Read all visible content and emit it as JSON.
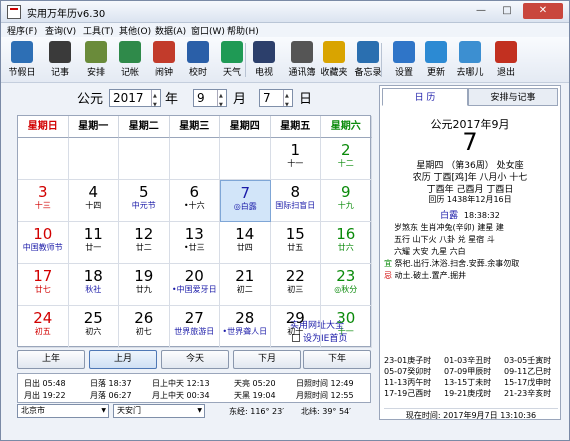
{
  "app": {
    "title": "实用万年历v6.30",
    "min": "—",
    "max": "□",
    "close": "✕"
  },
  "menu": [
    "程序(F)",
    "查询(V)",
    "工具(T)",
    "其他(O)",
    "数据(A)",
    "窗口(W)",
    "帮助(H)"
  ],
  "toolbar": [
    {
      "label": "节假日",
      "icon": "calendar-holiday-icon",
      "color": "#2d6fb5"
    },
    {
      "label": "记事",
      "icon": "notebook-icon",
      "color": "#3a3a3a"
    },
    {
      "label": "安排",
      "icon": "schedule-grid-icon",
      "color": "#6a8b3a"
    },
    {
      "label": "记帐",
      "icon": "ledger-icon",
      "color": "#2f8a4a"
    },
    {
      "label": "闹钟",
      "icon": "alarm-clock-icon",
      "color": "#c23b2b"
    },
    {
      "label": "校时",
      "icon": "globe-clock-icon",
      "color": "#2a5fa8"
    },
    {
      "label": "天气",
      "icon": "weather-icon",
      "color": "#1f9a55"
    },
    {
      "label": "电视",
      "icon": "tv-icon",
      "color": "#2c3f6b"
    },
    {
      "label": "通讯簿",
      "icon": "camera-contacts-icon",
      "color": "#555555"
    },
    {
      "label": "收藏夹",
      "icon": "star-favorites-icon",
      "color": "#d9a400"
    },
    {
      "label": "备忘录",
      "icon": "memo-icon",
      "color": "#2a6fb0"
    },
    {
      "label": "设置",
      "icon": "settings-icon",
      "color": "#2f75c8"
    },
    {
      "label": "更新",
      "icon": "update-globe-icon",
      "color": "#2c8ad3"
    },
    {
      "label": "去哪儿",
      "icon": "camel-icon",
      "color": "#3c8fd1"
    },
    {
      "label": "退出",
      "icon": "exit-icon",
      "color": "#c23020"
    }
  ],
  "nav": {
    "era": "公元",
    "year": "2017",
    "year_unit": "年",
    "month": "9",
    "month_unit": "月",
    "day": "7",
    "day_unit": "日"
  },
  "weekdays": [
    "星期日",
    "星期一",
    "星期二",
    "星期三",
    "星期四",
    "星期五",
    "星期六"
  ],
  "cells": [
    {
      "d": "",
      "l": "",
      "dc": "black",
      "lc": "black"
    },
    {
      "d": "",
      "l": "",
      "dc": "black",
      "lc": "black"
    },
    {
      "d": "",
      "l": "",
      "dc": "black",
      "lc": "black"
    },
    {
      "d": "",
      "l": "",
      "dc": "black",
      "lc": "black"
    },
    {
      "d": "",
      "l": "",
      "dc": "black",
      "lc": "black"
    },
    {
      "d": "1",
      "l": "十一",
      "dc": "black",
      "lc": "black"
    },
    {
      "d": "2",
      "l": "十二",
      "dc": "green",
      "lc": "green"
    },
    {
      "d": "3",
      "l": "十三",
      "dc": "red",
      "lc": "red"
    },
    {
      "d": "4",
      "l": "十四",
      "dc": "black",
      "lc": "black"
    },
    {
      "d": "5",
      "l": "中元节",
      "dc": "black",
      "lc": "blue"
    },
    {
      "d": "6",
      "l": "•十六",
      "dc": "black",
      "lc": "black"
    },
    {
      "d": "7",
      "l": "◎白露",
      "dc": "blue",
      "lc": "blue",
      "today": true
    },
    {
      "d": "8",
      "l": "国际扫盲日",
      "dc": "black",
      "lc": "blue"
    },
    {
      "d": "9",
      "l": "十九",
      "dc": "green",
      "lc": "green"
    },
    {
      "d": "10",
      "l": "中国教师节",
      "dc": "red",
      "lc": "blue"
    },
    {
      "d": "11",
      "l": "廿一",
      "dc": "black",
      "lc": "black"
    },
    {
      "d": "12",
      "l": "廿二",
      "dc": "black",
      "lc": "black"
    },
    {
      "d": "13",
      "l": "•廿三",
      "dc": "black",
      "lc": "black"
    },
    {
      "d": "14",
      "l": "廿四",
      "dc": "black",
      "lc": "black"
    },
    {
      "d": "15",
      "l": "廿五",
      "dc": "black",
      "lc": "black"
    },
    {
      "d": "16",
      "l": "廿六",
      "dc": "green",
      "lc": "green"
    },
    {
      "d": "17",
      "l": "廿七",
      "dc": "red",
      "lc": "red"
    },
    {
      "d": "18",
      "l": "秋社",
      "dc": "black",
      "lc": "blue"
    },
    {
      "d": "19",
      "l": "廿九",
      "dc": "black",
      "lc": "black"
    },
    {
      "d": "20",
      "l": "•中国爱牙日",
      "dc": "black",
      "lc": "blue"
    },
    {
      "d": "21",
      "l": "初二",
      "dc": "black",
      "lc": "black"
    },
    {
      "d": "22",
      "l": "初三",
      "dc": "black",
      "lc": "black"
    },
    {
      "d": "23",
      "l": "◎秋分",
      "dc": "green",
      "lc": "green"
    },
    {
      "d": "24",
      "l": "初五",
      "dc": "red",
      "lc": "red"
    },
    {
      "d": "25",
      "l": "初六",
      "dc": "black",
      "lc": "black"
    },
    {
      "d": "26",
      "l": "初七",
      "dc": "black",
      "lc": "black"
    },
    {
      "d": "27",
      "l": "世界旅游日",
      "dc": "black",
      "lc": "blue"
    },
    {
      "d": "28",
      "l": "•世界聋人日",
      "dc": "black",
      "lc": "blue"
    },
    {
      "d": "29",
      "l": "初十",
      "dc": "black",
      "lc": "black"
    },
    {
      "d": "30",
      "l": "十一",
      "dc": "green",
      "lc": "green"
    }
  ],
  "links": {
    "site": "实用网址大全",
    "homepage": "设为IE首页"
  },
  "buttons": [
    "上年",
    "上月",
    "今天",
    "下月",
    "下年"
  ],
  "sun": {
    "rise": "日出 05:48",
    "set": "日落 18:37",
    "transit": "日上中天 12:13",
    "dawn": "天亮 05:20",
    "dur": "日照时间 12:49",
    "moonrise": "月出 19:22",
    "moonset": "月落 06:27",
    "mtransit": "月上中天 00:34",
    "dark": "天黑 19:04",
    "mdur": "月照时间 12:55"
  },
  "loc": {
    "city": "北京市",
    "place": "天安门",
    "lon": "东经: 116° 23′",
    "lat": "北纬: 39° 54′"
  },
  "tabs": {
    "day": "日    历",
    "plan": "安排与记事"
  },
  "detail": {
    "ym": "公元2017年9月",
    "day": "7",
    "week": "星期四 （第36周） 处女座",
    "lunar": "农历 丁酉[鸡]年 八月小 十七",
    "gz1": "丁酉年 己酉月 丁酉日",
    "greg": "回历 1438年12月16日",
    "term": "白露",
    "termtime": "18:38:32",
    "l1": "岁煞东 生肖冲兔(辛卯)  建星 建",
    "l2": "五行 山下火  八卦 兑  星宿 斗",
    "l3": "六耀 大安  九星 六白",
    "yi": "宜",
    "yi_text": "祭祀.出行.沐浴.扫舍.安葬.余事勿取",
    "ji": "忌",
    "ji_text": "动土.破土.置产.掘井"
  },
  "hours": [
    [
      "23-01庚子时",
      "01-03辛丑时",
      "03-05壬寅时"
    ],
    [
      "05-07癸卯时",
      "07-09甲辰时",
      "09-11乙巳时"
    ],
    [
      "11-13丙午时",
      "13-15丁未时",
      "15-17戊申时"
    ],
    [
      "17-19己酉时",
      "19-21庚戌时",
      "21-23辛亥时"
    ]
  ],
  "now": "现在时间: 2017年9月7日 13:10:36"
}
